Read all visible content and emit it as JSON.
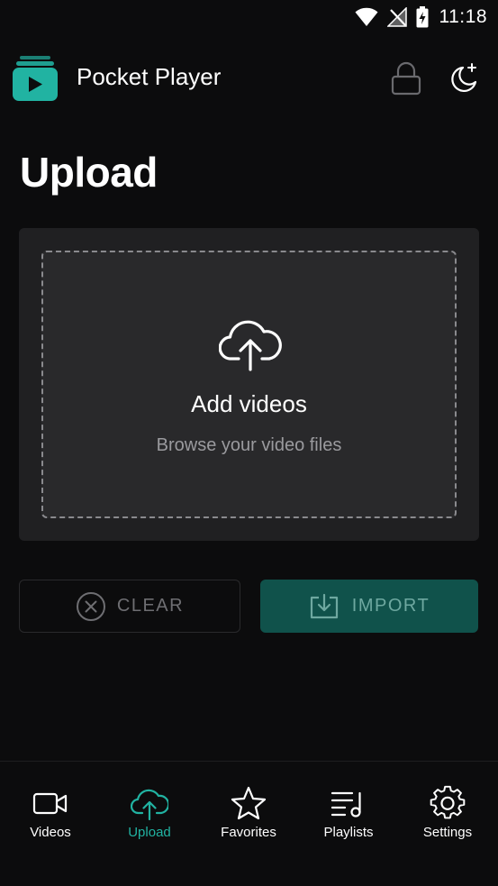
{
  "status_bar": {
    "time": "11:18"
  },
  "app_bar": {
    "title": "Pocket Player"
  },
  "page": {
    "title": "Upload"
  },
  "upload_card": {
    "title": "Add videos",
    "subtitle": "Browse your video files"
  },
  "actions": {
    "clear_label": "CLEAR",
    "import_label": "IMPORT"
  },
  "bottom_nav": {
    "items": [
      {
        "label": "Videos",
        "icon": "video-camera-icon",
        "active": false
      },
      {
        "label": "Upload",
        "icon": "cloud-upload-icon",
        "active": true
      },
      {
        "label": "Favorites",
        "icon": "star-icon",
        "active": false
      },
      {
        "label": "Playlists",
        "icon": "playlist-icon",
        "active": false
      },
      {
        "label": "Settings",
        "icon": "gear-icon",
        "active": false
      }
    ]
  },
  "colors": {
    "background": "#0c0c0d",
    "accent": "#21b3a2",
    "import_button": "#10524b",
    "card": "#202022"
  }
}
